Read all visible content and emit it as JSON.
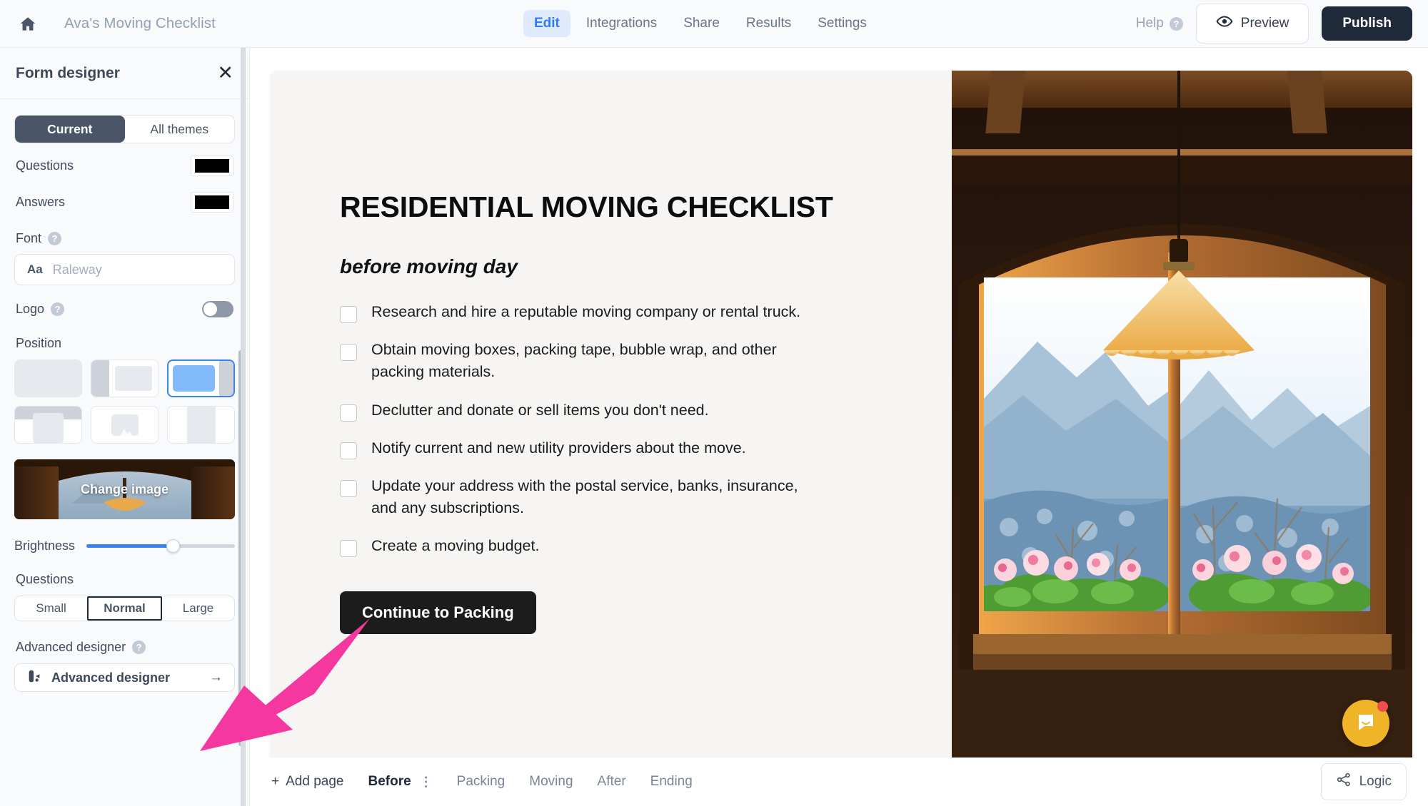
{
  "topbar": {
    "home_icon": "home-icon",
    "doc_title": "Ava's Moving Checklist",
    "tabs": [
      {
        "label": "Edit",
        "active": true
      },
      {
        "label": "Integrations",
        "active": false
      },
      {
        "label": "Share",
        "active": false
      },
      {
        "label": "Results",
        "active": false
      },
      {
        "label": "Settings",
        "active": false
      }
    ],
    "help_label": "Help",
    "help_badge": "?",
    "preview_label": "Preview",
    "publish_label": "Publish"
  },
  "sidepanel": {
    "title": "Form designer",
    "close_icon": "close-icon",
    "theme_tabs": [
      {
        "label": "Current",
        "active": true
      },
      {
        "label": "All themes",
        "active": false
      }
    ],
    "questions_color_label": "Questions",
    "questions_color": "#000000",
    "answers_color_label": "Answers",
    "answers_color": "#000000",
    "font_label": "Font",
    "font_prefix": "Aa",
    "font_value": "Raleway",
    "logo_label": "Logo",
    "logo_enabled": false,
    "position_label": "Position",
    "position_selected_index": 2,
    "change_image_label": "Change image",
    "brightness_label": "Brightness",
    "brightness_percent": 58,
    "questions_size_label": "Questions",
    "size_options": [
      {
        "label": "Small",
        "active": false
      },
      {
        "label": "Normal",
        "active": true
      },
      {
        "label": "Large",
        "active": false
      }
    ],
    "advanced_label": "Advanced designer",
    "advanced_button_label": "Advanced designer",
    "advanced_arrow": "→"
  },
  "form": {
    "title": "RESIDENTIAL MOVING CHECKLIST",
    "subtitle": "before moving day",
    "items": [
      "Research and hire a reputable moving company or rental truck.",
      "Obtain moving boxes, packing tape, bubble wrap, and other packing materials.",
      "Declutter and donate or sell items you don't need.",
      "Notify current and new utility providers about the move.",
      "Update your address with the postal service, banks, insurance, and any subscriptions.",
      "Create a moving budget."
    ],
    "cta_label": "Continue to Packing"
  },
  "bottombar": {
    "add_page_label": "Add page",
    "add_page_plus": "+",
    "pages": [
      {
        "label": "Before",
        "active": true
      },
      {
        "label": "Packing",
        "active": false
      },
      {
        "label": "Moving",
        "active": false
      },
      {
        "label": "After",
        "active": false
      },
      {
        "label": "Ending",
        "active": false
      }
    ],
    "kebab_icon": "kebab-menu-icon",
    "logic_label": "Logic"
  },
  "annotation": {
    "arrow_color": "#f5389f"
  },
  "colors": {
    "accent_blue": "#3b82f6",
    "publish_dark": "#1e2939",
    "intercom_yellow": "#f0b429",
    "badge_red": "#f04d4d"
  }
}
